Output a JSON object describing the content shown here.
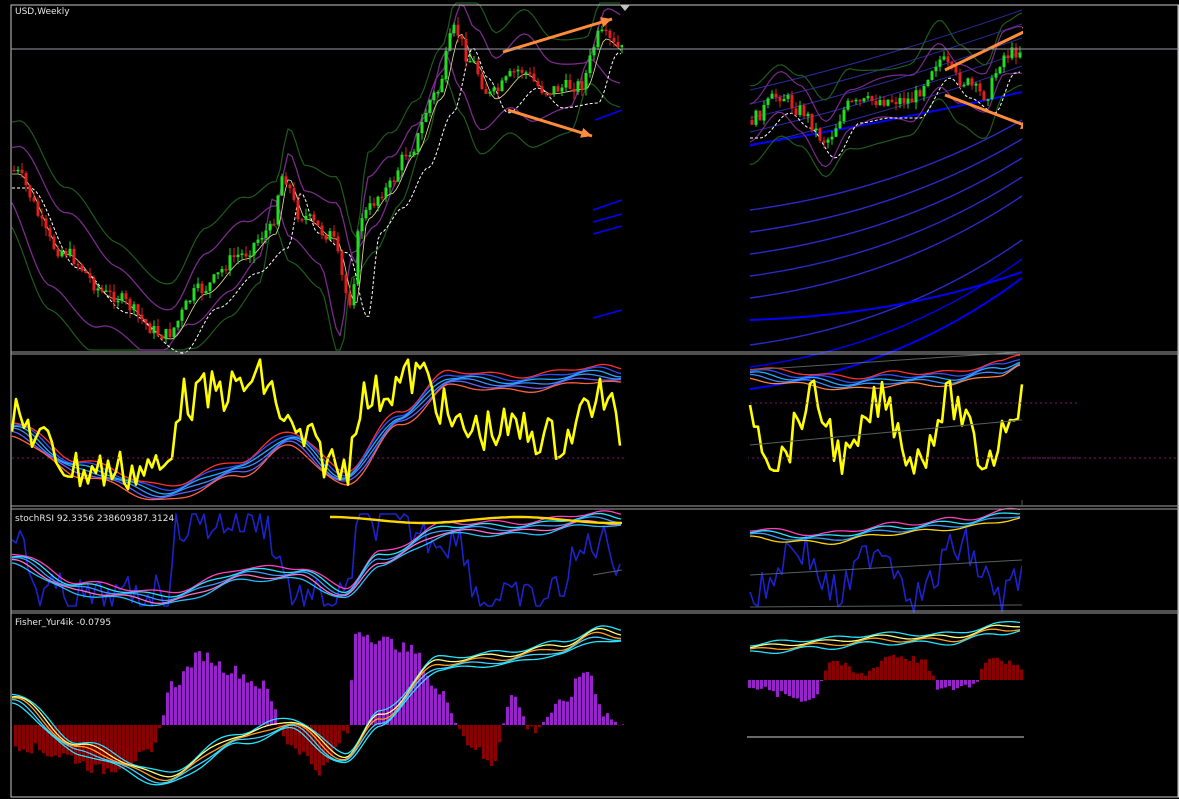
{
  "window": {
    "chart_title": "USD,Weekly"
  },
  "indicators": {
    "stoch_label": "stochRSI 92.3356 238609387.3124",
    "fisher_label": "Fisher_Yur4ik -0.0795"
  },
  "colors": {
    "background": "#000000",
    "bull_candle": "#22dd22",
    "bear_candle": "#e02020",
    "yellow_line": "#ffff00",
    "purple_band": "#7a2a8a",
    "green_band": "#1e5a1e",
    "blue_line": "#0000ff",
    "cyan_line": "#22e6ff",
    "histogram_up": "#9a22cc",
    "histogram_down": "#8b0000",
    "arrow": "#ff8c3a",
    "pane_border": "#c8c8c8"
  }
}
